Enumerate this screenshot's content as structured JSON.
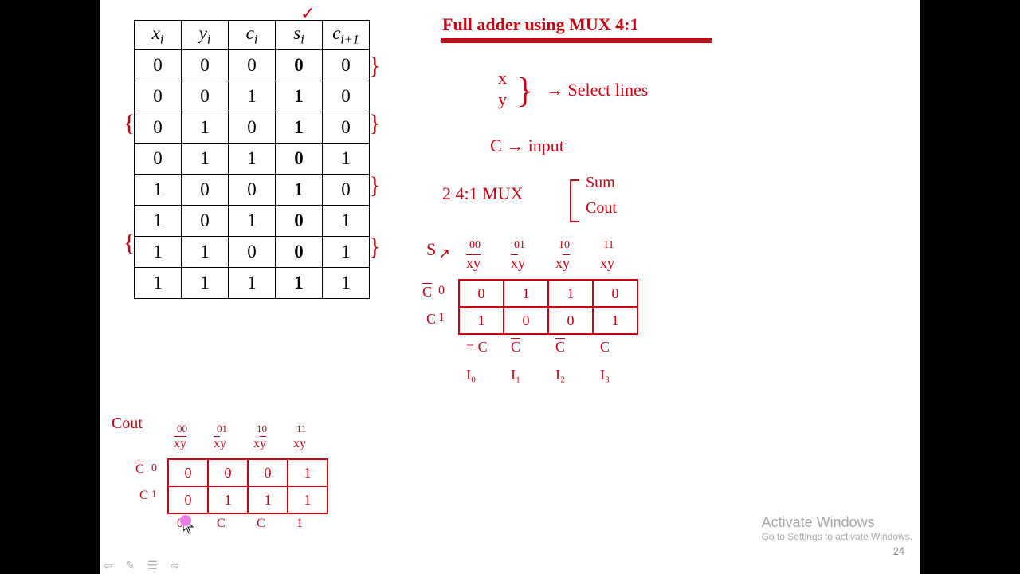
{
  "truth_table": {
    "headers": [
      "xᵢ",
      "yᵢ",
      "cᵢ",
      "sᵢ",
      "cᵢ₊₁"
    ],
    "rows": [
      [
        "0",
        "0",
        "0",
        "0",
        "0"
      ],
      [
        "0",
        "0",
        "1",
        "1",
        "0"
      ],
      [
        "0",
        "1",
        "0",
        "1",
        "0"
      ],
      [
        "0",
        "1",
        "1",
        "0",
        "1"
      ],
      [
        "1",
        "0",
        "0",
        "1",
        "0"
      ],
      [
        "1",
        "0",
        "1",
        "0",
        "1"
      ],
      [
        "1",
        "1",
        "0",
        "0",
        "1"
      ],
      [
        "1",
        "1",
        "1",
        "1",
        "1"
      ]
    ],
    "bold_cols": [
      3
    ]
  },
  "title": "Full adder using MUX 4:1",
  "notes": {
    "sel_x": "x",
    "sel_y": "y",
    "sel_label": "→ Select lines",
    "input_c": "C → input",
    "two_mux": "2  4:1 MUX",
    "mux_sum": "Sum",
    "mux_cout": "Cout",
    "sum_lbl": "S"
  },
  "sum_kmap": {
    "col_bits": [
      "00",
      "01",
      "10",
      "11"
    ],
    "col_hdr": [
      "x̄ȳ",
      "x̄y",
      "xȳ",
      "xy"
    ],
    "row_hdr": [
      "C̄",
      "C"
    ],
    "row_bits": [
      "0",
      "1"
    ],
    "cells": [
      [
        "0",
        "1",
        "1",
        "0"
      ],
      [
        "1",
        "0",
        "0",
        "1"
      ]
    ],
    "outs": [
      "= C",
      "C̄",
      "C̄",
      "C"
    ],
    "ilbl": [
      "I₀",
      "I₁",
      "I₂",
      "I₃"
    ]
  },
  "cout_kmap": {
    "title": "Cout",
    "col_bits": [
      "00",
      "01",
      "10",
      "11"
    ],
    "col_hdr": [
      "x̄ȳ",
      "x̄y",
      "xȳ",
      "xy"
    ],
    "row_hdr": [
      "C̄",
      "C"
    ],
    "row_bits": [
      "0",
      "1"
    ],
    "cells": [
      [
        "0",
        "0",
        "0",
        "1"
      ],
      [
        "0",
        "1",
        "1",
        "1"
      ]
    ],
    "outs": [
      "0",
      "C",
      "C",
      "1"
    ]
  },
  "watermark": {
    "line1": "Activate Windows",
    "line2": "Go to Settings to activate Windows."
  },
  "page_number": "24"
}
